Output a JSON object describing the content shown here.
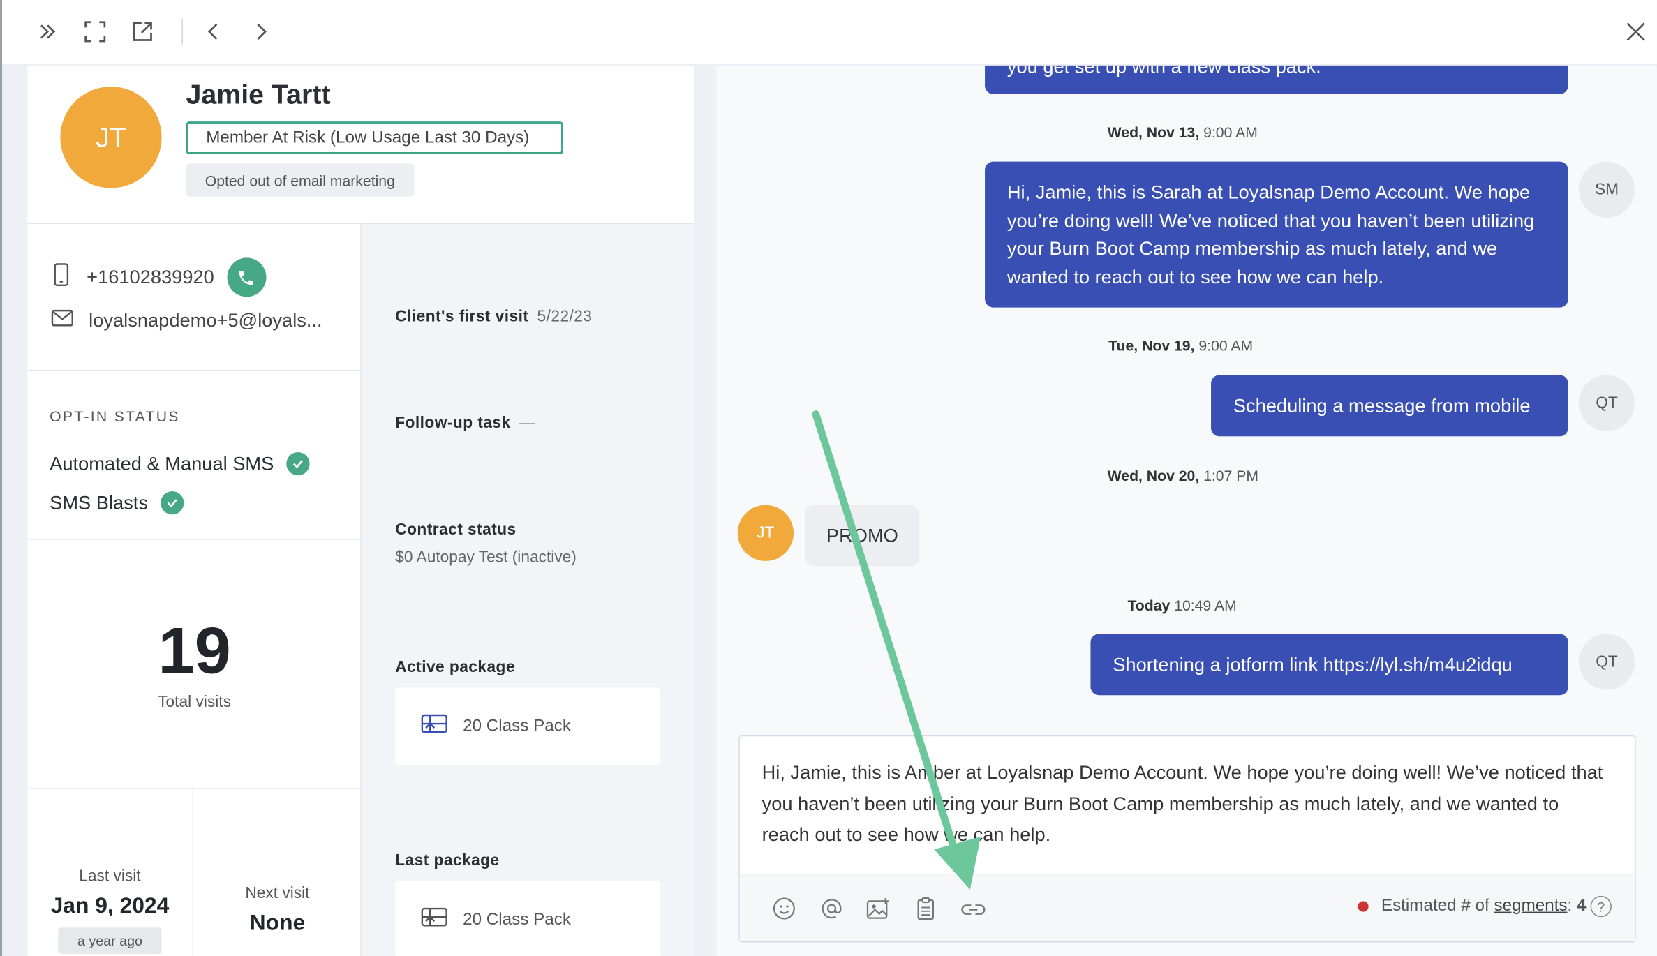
{
  "toolbar": {
    "icons": [
      "double-chevron-right-icon",
      "expand-icon",
      "open-external-icon",
      "chevron-left-icon",
      "chevron-right-icon",
      "close-icon"
    ]
  },
  "profile": {
    "initials": "JT",
    "name": "Jamie Tartt",
    "risk_badge": "Member At Risk (Low Usage Last 30 Days)",
    "email_opt_badge": "Opted out of email marketing"
  },
  "contact": {
    "phone": "+16102839920",
    "email": "loyalsnapdemo+5@loyals..."
  },
  "opt_in": {
    "title": "OPT-IN STATUS",
    "items": [
      "Automated & Manual SMS",
      "SMS Blasts"
    ]
  },
  "visits": {
    "total": "19",
    "total_label": "Total visits",
    "last_label": "Last visit",
    "last_value": "Jan 9, 2024",
    "last_ago": "a year ago",
    "next_label": "Next visit",
    "next_value": "None"
  },
  "details": {
    "first_visit_label": "Client's first visit",
    "first_visit_value": "5/22/23",
    "followup_label": "Follow-up task",
    "followup_value": "—",
    "contract_label": "Contract status",
    "contract_value": "$0 Autopay Test (inactive)",
    "active_package_label": "Active package",
    "active_package_value": "20 Class Pack",
    "last_package_label": "Last package",
    "last_package_value": "20 Class Pack"
  },
  "chat": {
    "top_partial": "you get set up with a new class pack.",
    "messages": [
      {
        "date": "Wed, Nov 13,",
        "time": "9:00 AM",
        "text": "Hi, Jamie, this is Sarah at Loyalsnap Demo Account. We hope you’re doing well! We’ve noticed that you haven’t been utilizing your Burn Boot Camp membership as much lately, and we wanted to reach out to see how we can help.",
        "sender": "SM"
      },
      {
        "date": "Tue, Nov 19,",
        "time": "9:00 AM",
        "text": "Scheduling a message from mobile",
        "sender": "QT"
      },
      {
        "date": "Wed, Nov 20,",
        "time": "1:07 PM",
        "text": "PROMO",
        "sender": "JT"
      },
      {
        "date": "Today",
        "time": "10:49 AM",
        "text": "Shortening a jotform link https://lyl.sh/m4u2idqu",
        "sender": "QT"
      }
    ]
  },
  "composer": {
    "text": "Hi, Jamie, this is Amber at Loyalsnap Demo Account. We hope you’re doing well! We’ve noticed that you haven’t been utilizing your Burn Boot Camp membership as much lately, and we wanted to reach out to see how we can help.",
    "icons": [
      "emoji-icon",
      "mention-icon",
      "image-icon",
      "template-icon",
      "link-icon"
    ],
    "segments_prefix": "Estimated # of",
    "segments_link": "segments",
    "segments_colon": ":",
    "segments_value": "4",
    "help": "?"
  },
  "colors": {
    "accent_orange": "#f2a93b",
    "outgoing_bubble": "#3a4fb3",
    "green": "#47a886",
    "annotation_arrow": "#6cc79a"
  }
}
